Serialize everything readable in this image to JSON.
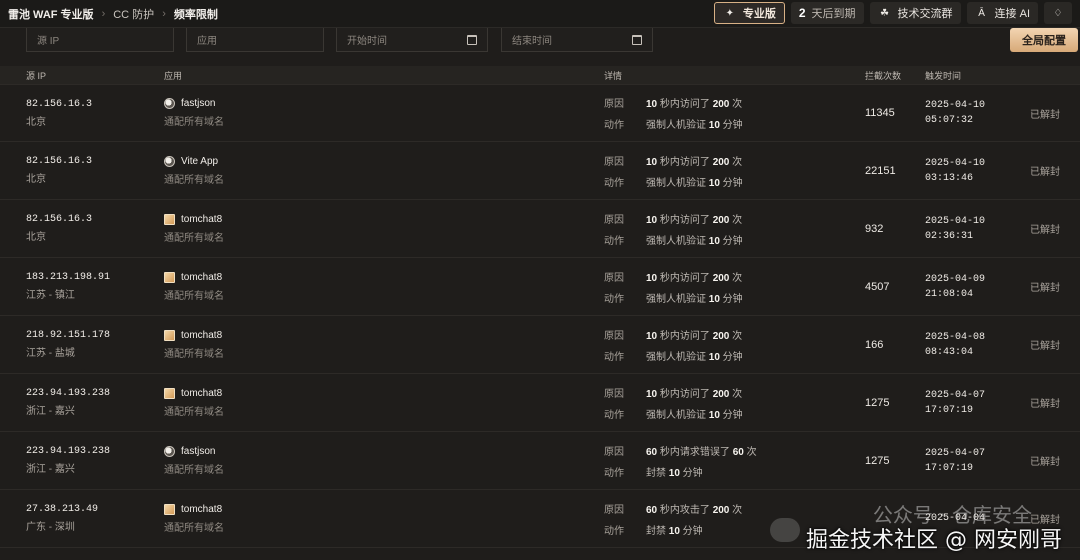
{
  "topbar": {
    "breadcrumb": [
      "雷池 WAF 专业版",
      "CC 防护",
      "频率限制"
    ],
    "pro_label": "专业版",
    "days_value": "2",
    "days_label": "天后到期",
    "group_label": "技术交流群",
    "ai_label": "连接 AI"
  },
  "filters": {
    "ip_placeholder": "源 IP",
    "app_placeholder": "应用",
    "start_placeholder": "开始时间",
    "end_placeholder": "结束时间",
    "global_button": "全局配置"
  },
  "table": {
    "headers": [
      "源 IP",
      "应用",
      "详情",
      "拦截次数",
      "触发时间"
    ],
    "rows": [
      {
        "ip": "82.156.16.3",
        "loc": "北京",
        "app": "fastjson",
        "app_sub": "通配所有域名",
        "icon": "globe-icon",
        "reason_label": "原因",
        "reason_a": "10",
        "reason_b": " 秒内访问了 ",
        "reason_c": "200",
        "reason_d": " 次",
        "action_label": "动作",
        "action_a": "强制人机验证 ",
        "action_b": "10",
        "action_c": " 分钟",
        "count": "11345",
        "date": "2025-04-10",
        "time": "05:07:32",
        "status": "已解封"
      },
      {
        "ip": "82.156.16.3",
        "loc": "北京",
        "app": "Vite App",
        "app_sub": "通配所有域名",
        "icon": "globe-icon",
        "reason_label": "原因",
        "reason_a": "10",
        "reason_b": " 秒内访问了 ",
        "reason_c": "200",
        "reason_d": " 次",
        "action_label": "动作",
        "action_a": "强制人机验证 ",
        "action_b": "10",
        "action_c": " 分钟",
        "count": "22151",
        "date": "2025-04-10",
        "time": "03:13:46",
        "status": "已解封"
      },
      {
        "ip": "82.156.16.3",
        "loc": "北京",
        "app": "tomchat8",
        "app_sub": "通配所有域名",
        "icon": "tomcat-icon",
        "reason_label": "原因",
        "reason_a": "10",
        "reason_b": " 秒内访问了 ",
        "reason_c": "200",
        "reason_d": " 次",
        "action_label": "动作",
        "action_a": "强制人机验证 ",
        "action_b": "10",
        "action_c": " 分钟",
        "count": "932",
        "date": "2025-04-10",
        "time": "02:36:31",
        "status": "已解封"
      },
      {
        "ip": "183.213.198.91",
        "loc": "江苏 - 镇江",
        "app": "tomchat8",
        "app_sub": "通配所有域名",
        "icon": "tomcat-icon",
        "reason_label": "原因",
        "reason_a": "10",
        "reason_b": " 秒内访问了 ",
        "reason_c": "200",
        "reason_d": " 次",
        "action_label": "动作",
        "action_a": "强制人机验证 ",
        "action_b": "10",
        "action_c": " 分钟",
        "count": "4507",
        "date": "2025-04-09",
        "time": "21:08:04",
        "status": "已解封"
      },
      {
        "ip": "218.92.151.178",
        "loc": "江苏 - 盐城",
        "app": "tomchat8",
        "app_sub": "通配所有域名",
        "icon": "tomcat-icon",
        "reason_label": "原因",
        "reason_a": "10",
        "reason_b": " 秒内访问了 ",
        "reason_c": "200",
        "reason_d": " 次",
        "action_label": "动作",
        "action_a": "强制人机验证 ",
        "action_b": "10",
        "action_c": " 分钟",
        "count": "166",
        "date": "2025-04-08",
        "time": "08:43:04",
        "status": "已解封"
      },
      {
        "ip": "223.94.193.238",
        "loc": "浙江 - 嘉兴",
        "app": "tomchat8",
        "app_sub": "通配所有域名",
        "icon": "tomcat-icon",
        "reason_label": "原因",
        "reason_a": "10",
        "reason_b": " 秒内访问了 ",
        "reason_c": "200",
        "reason_d": " 次",
        "action_label": "动作",
        "action_a": "强制人机验证 ",
        "action_b": "10",
        "action_c": " 分钟",
        "count": "1275",
        "date": "2025-04-07",
        "time": "17:07:19",
        "status": "已解封"
      },
      {
        "ip": "223.94.193.238",
        "loc": "浙江 - 嘉兴",
        "app": "fastjson",
        "app_sub": "通配所有域名",
        "icon": "globe-icon",
        "reason_label": "原因",
        "reason_a": "60",
        "reason_b": " 秒内请求错误了 ",
        "reason_c": "60",
        "reason_d": " 次",
        "action_label": "动作",
        "action_a": "封禁 ",
        "action_b": "10",
        "action_c": " 分钟",
        "count": "1275",
        "date": "2025-04-07",
        "time": "17:07:19",
        "status": "已解封"
      },
      {
        "ip": "27.38.213.49",
        "loc": "广东 - 深圳",
        "app": "tomchat8",
        "app_sub": "通配所有域名",
        "icon": "tomcat-icon",
        "reason_label": "原因",
        "reason_a": "60",
        "reason_b": " 秒内攻击了 ",
        "reason_c": "200",
        "reason_d": " 次",
        "action_label": "动作",
        "action_a": "封禁 ",
        "action_b": "10",
        "action_c": " 分钟",
        "count": "",
        "date": "2025-04-04",
        "time": "",
        "status": "已解封"
      }
    ]
  },
  "watermark": {
    "main": "掘金技术社区 @ 网安刚哥",
    "faint": "公众号 · 仓库安全"
  },
  "colors": {
    "background": "#1f1d1b",
    "accent": "#d8b186"
  }
}
